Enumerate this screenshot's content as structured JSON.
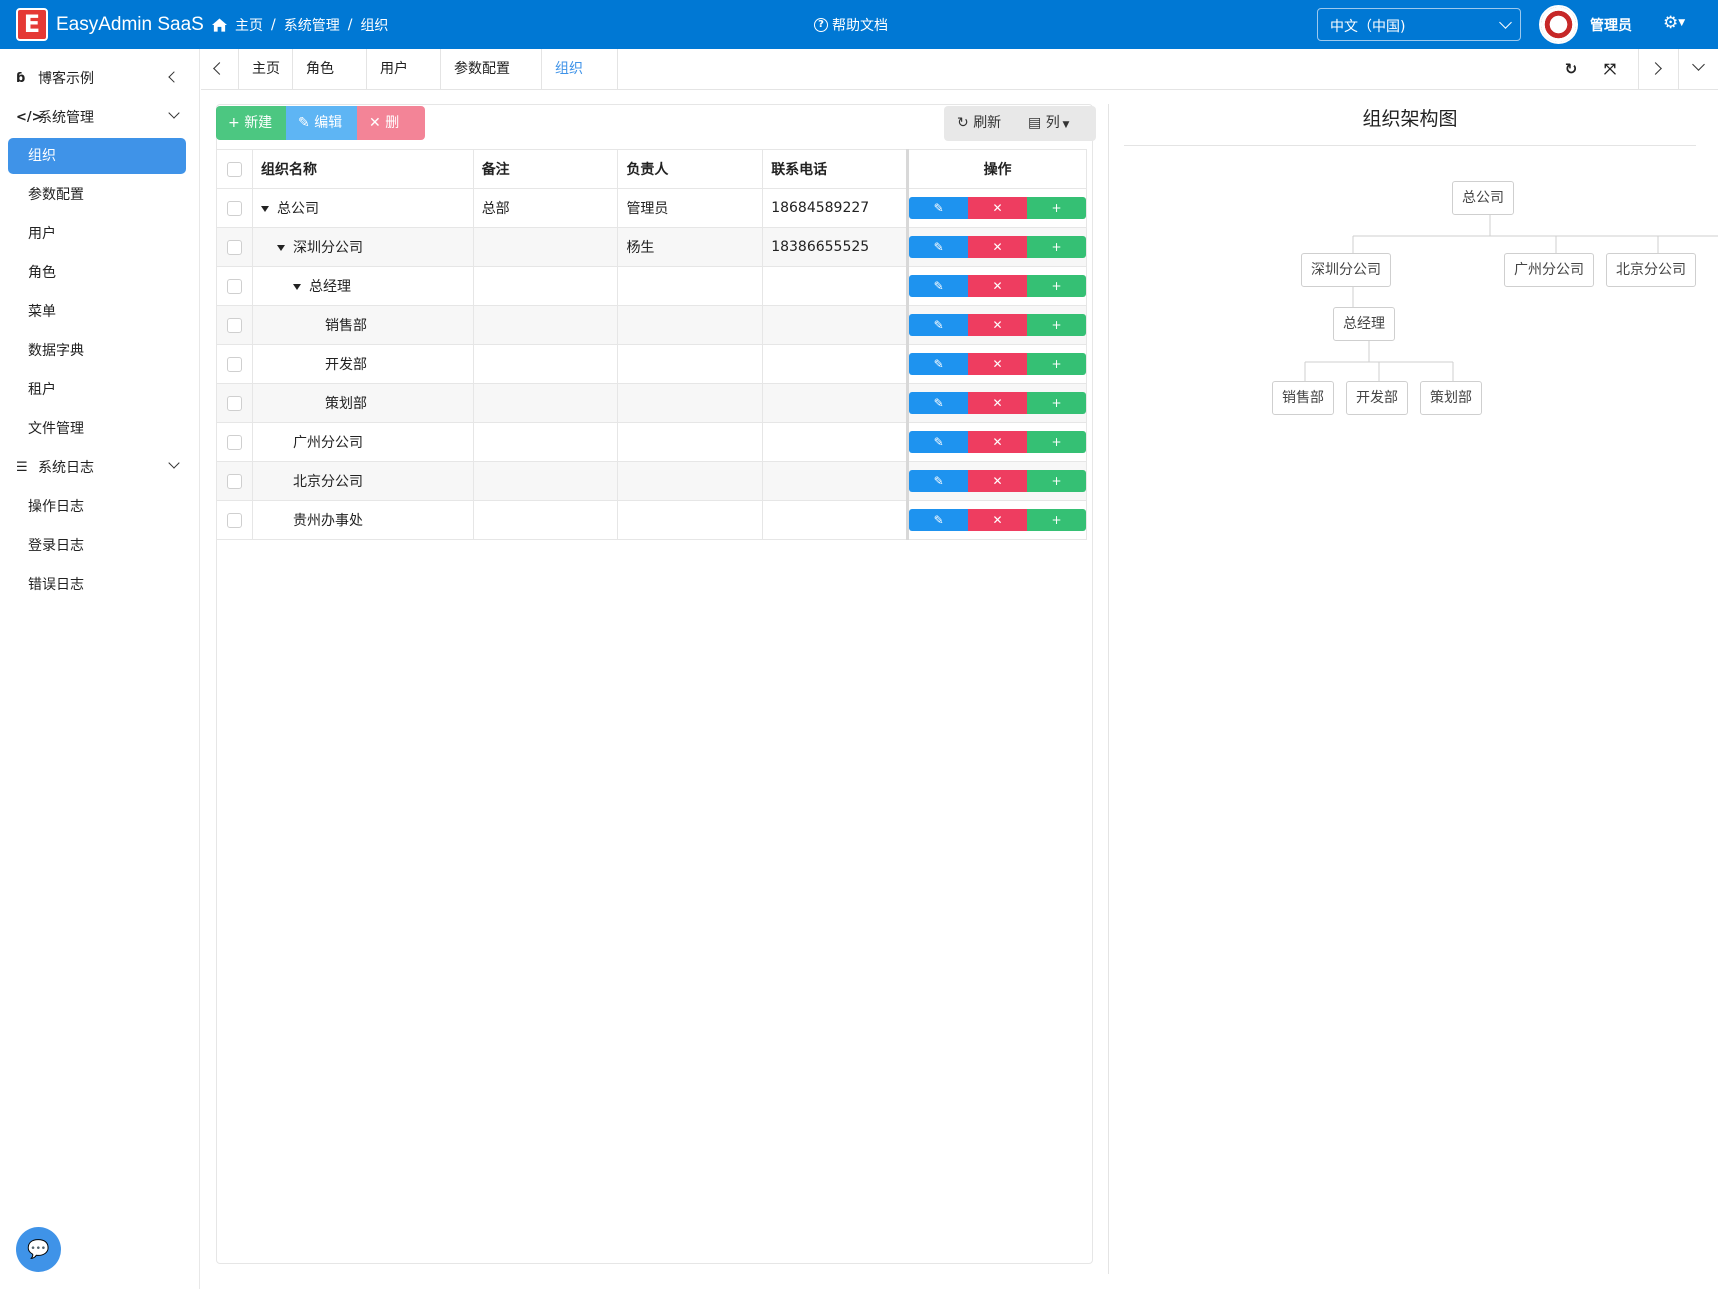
{
  "header": {
    "app_name": "EasyAdmin SaaS",
    "breadcrumb": [
      "主页",
      "/",
      "系统管理",
      "/",
      "组织"
    ],
    "help_label": "帮助文档",
    "language": "中文（中国)",
    "user_name": "管理员",
    "brand_color": "#0078d4"
  },
  "sidebar": {
    "groups": [
      {
        "label": "博客示例",
        "icon": "blog-icon",
        "expanded": false
      },
      {
        "label": "系统管理",
        "icon": "code-icon",
        "expanded": true
      },
      {
        "label": "系统日志",
        "icon": "server-icon",
        "expanded": true
      }
    ],
    "system_items": [
      "组织",
      "参数配置",
      "用户",
      "角色",
      "菜单",
      "数据字典",
      "租户",
      "文件管理"
    ],
    "log_items": [
      "操作日志",
      "登录日志",
      "错误日志"
    ],
    "active_item": "组织",
    "accent_color": "#3f93e8"
  },
  "tabs": {
    "items": [
      "主页",
      "角色",
      "用户",
      "参数配置",
      "组织"
    ],
    "active": "组织"
  },
  "toolbar": {
    "new_label": "新建",
    "edit_label": "编辑",
    "delete_label": "删除",
    "refresh_label": "刷新",
    "columns_label": "列"
  },
  "table": {
    "columns": [
      "组织名称",
      "备注",
      "负责人",
      "联系电话",
      "操作"
    ],
    "rows": [
      {
        "name": "总公司",
        "level": 0,
        "expanded": true,
        "remark": "总部",
        "owner": "管理员",
        "phone": "18684589227"
      },
      {
        "name": "深圳分公司",
        "level": 1,
        "expanded": true,
        "remark": "",
        "owner": "杨生",
        "phone": "18386655525"
      },
      {
        "name": "总经理",
        "level": 2,
        "expanded": true,
        "remark": "",
        "owner": "",
        "phone": ""
      },
      {
        "name": "销售部",
        "level": 3,
        "expanded": false,
        "remark": "",
        "owner": "",
        "phone": ""
      },
      {
        "name": "开发部",
        "level": 3,
        "expanded": false,
        "remark": "",
        "owner": "",
        "phone": ""
      },
      {
        "name": "策划部",
        "level": 3,
        "expanded": false,
        "remark": "",
        "owner": "",
        "phone": ""
      },
      {
        "name": "广州分公司",
        "level": 1,
        "expanded": false,
        "remark": "",
        "owner": "",
        "phone": ""
      },
      {
        "name": "北京分公司",
        "level": 1,
        "expanded": false,
        "remark": "",
        "owner": "",
        "phone": ""
      },
      {
        "name": "贵州办事处",
        "level": 1,
        "expanded": false,
        "remark": "",
        "owner": "",
        "phone": ""
      }
    ],
    "row_actions": {
      "edit": "编辑",
      "delete": "删除",
      "add": "增加"
    }
  },
  "org_chart": {
    "title": "组织架构图",
    "root": "总公司",
    "level1": [
      "深圳分公司",
      "广州分公司",
      "北京分公司"
    ],
    "level2": "总经理",
    "level3": [
      "销售部",
      "开发部",
      "策划部"
    ]
  }
}
